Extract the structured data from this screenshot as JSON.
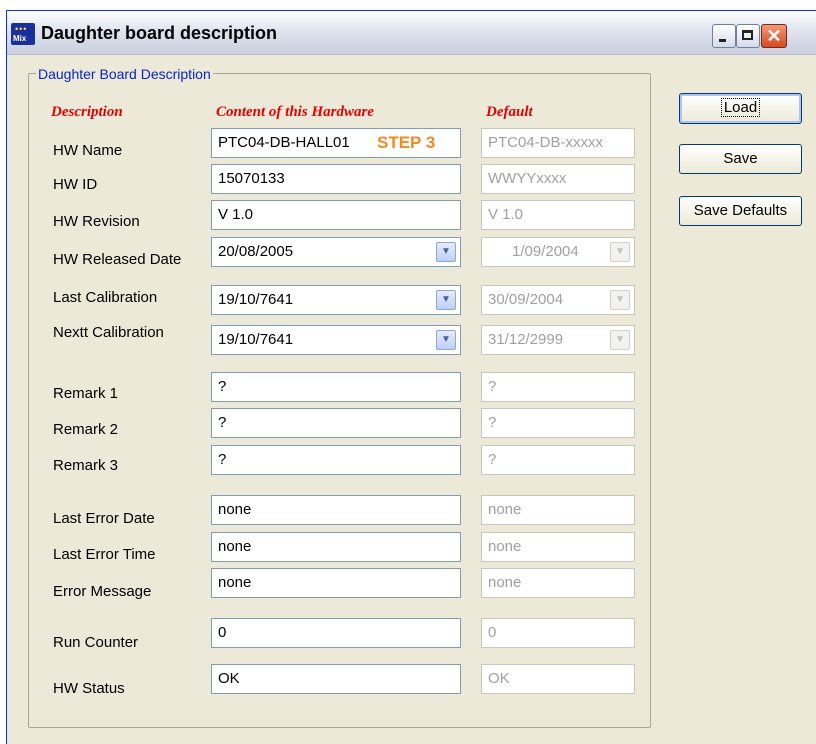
{
  "window": {
    "title": "Daughter board description",
    "icon": "mix-app-icon",
    "icon_text": "Mix",
    "close_glyph": "✕"
  },
  "group_title": "Daughter Board Description",
  "columns": {
    "description": "Description",
    "content": "Content of this Hardware",
    "default": "Default"
  },
  "annotation": "STEP 3",
  "fields": {
    "hw_name": {
      "label": "HW Name",
      "value": "PTC04-DB-HALL01",
      "default": "PTC04-DB-xxxxx"
    },
    "hw_id": {
      "label": "HW ID",
      "value": "15070133",
      "default": "WWYYxxxx"
    },
    "hw_revision": {
      "label": "HW Revision",
      "value": "V 1.0",
      "default": "V 1.0"
    },
    "hw_released_date": {
      "label": "HW Released Date",
      "value": "20/08/2005",
      "default": "1/09/2004"
    },
    "last_calibration": {
      "label": "Last Calibration",
      "value": "19/10/7641",
      "default": "30/09/2004"
    },
    "next_calibration": {
      "label": "Nextt Calibration",
      "value": "19/10/7641",
      "default": "31/12/2999"
    },
    "remark1": {
      "label": "Remark 1",
      "value": "?",
      "default": "?"
    },
    "remark2": {
      "label": "Remark 2",
      "value": "?",
      "default": "?"
    },
    "remark3": {
      "label": "Remark 3",
      "value": "?",
      "default": "?"
    },
    "last_error_date": {
      "label": "Last Error Date",
      "value": "none",
      "default": "none"
    },
    "last_error_time": {
      "label": "Last Error Time",
      "value": "none",
      "default": "none"
    },
    "error_message": {
      "label": "Error Message",
      "value": "none",
      "default": "none"
    },
    "run_counter": {
      "label": "Run Counter",
      "value": "0",
      "default": "0"
    },
    "hw_status": {
      "label": "HW Status",
      "value": "OK",
      "default": "OK"
    }
  },
  "buttons": {
    "load": "Load",
    "save": "Save",
    "save_defaults": "Save Defaults"
  },
  "colors": {
    "column_heading": "#e60000",
    "group_title": "#0a24c4",
    "annotation": "#f28a1c",
    "window_bg": "#ece9d8"
  }
}
